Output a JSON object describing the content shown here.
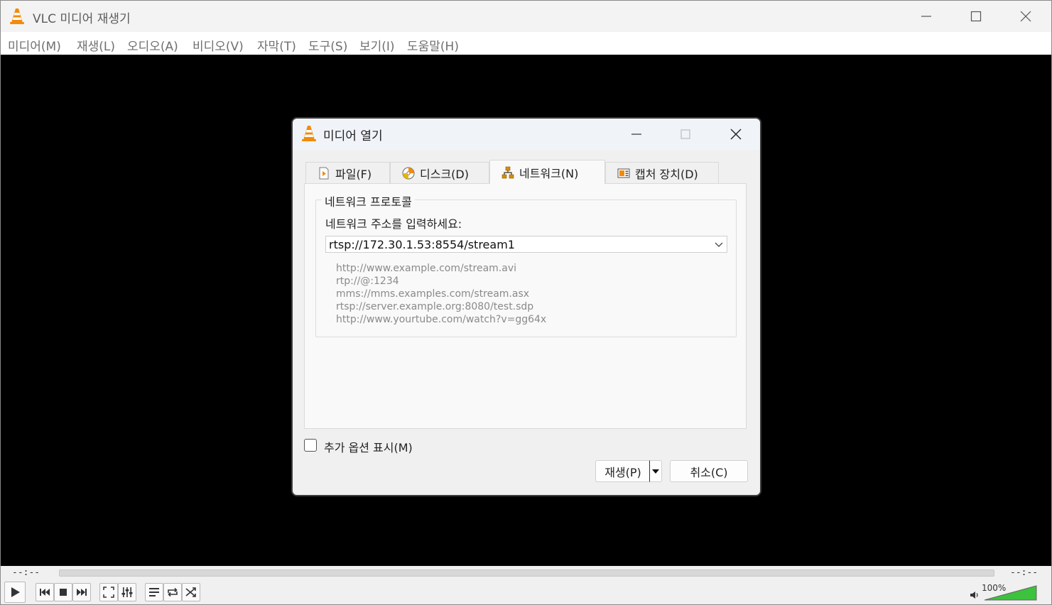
{
  "window": {
    "title": "VLC 미디어 재생기"
  },
  "menu": [
    {
      "label": "미디어(M)"
    },
    {
      "label": "재생(L)"
    },
    {
      "label": "오디오(A)"
    },
    {
      "label": "비디오(V)"
    },
    {
      "label": "자막(T)"
    },
    {
      "label": "도구(S)"
    },
    {
      "label": "보기(I)"
    },
    {
      "label": "도움말(H)"
    }
  ],
  "controls": {
    "elapsed": "--:--",
    "remaining": "--:--",
    "volume_label": "100%",
    "volume_level": 1.0
  },
  "dialog": {
    "title": "미디어 열기",
    "tabs": [
      {
        "label": "파일(F)",
        "icon": "file-icon"
      },
      {
        "label": "디스크(D)",
        "icon": "disc-icon"
      },
      {
        "label": "네트워크(N)",
        "icon": "network-icon",
        "active": true
      },
      {
        "label": "캡처 장치(D)",
        "icon": "capture-icon"
      }
    ],
    "group_title": "네트워크 프로토콜",
    "address_label": "네트워크 주소를 입력하세요:",
    "address_value": "rtsp://172.30.1.53:8554/stream1",
    "examples": [
      "http://www.example.com/stream.avi",
      "rtp://@:1234",
      "mms://mms.examples.com/stream.asx",
      "rtsp://server.example.org:8080/test.sdp",
      "http://www.yourtube.com/watch?v=gg64x"
    ],
    "show_more_label": "추가 옵션 표시(M)",
    "play_label": "재생(P)",
    "cancel_label": "취소(C)"
  },
  "colors": {
    "vlc_orange": "#f28b0c",
    "video_bg": "#000000",
    "volume_green": "#3cc23c"
  }
}
